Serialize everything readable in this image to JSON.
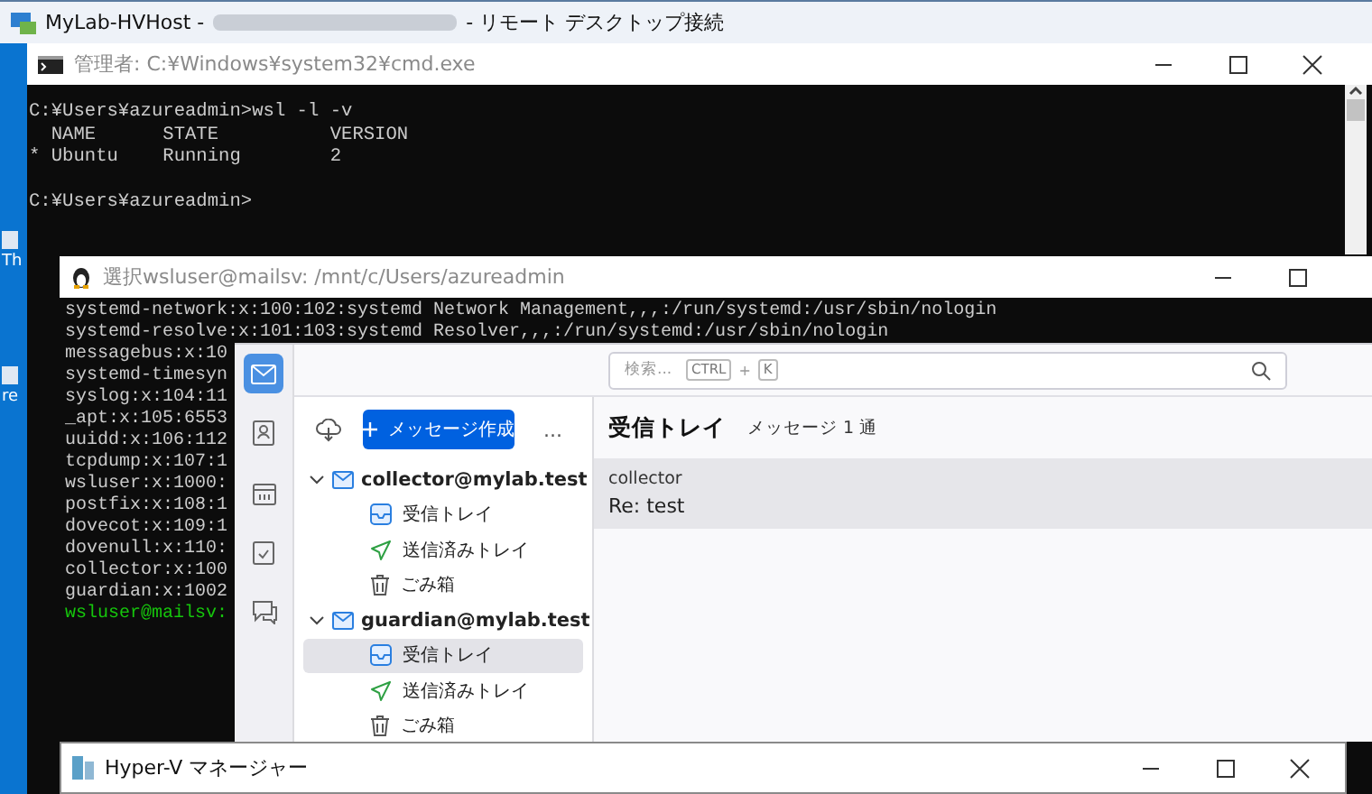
{
  "rdp_window": {
    "title_prefix": "MyLab-HVHost -",
    "title_suffix": "- リモート デスクトップ接続"
  },
  "desktop_icons": [
    {
      "label": "Th"
    },
    {
      "label": "re"
    }
  ],
  "cmd_window": {
    "title": "管理者: C:¥Windows¥system32¥cmd.exe",
    "active": false,
    "blocks": [
      [
        "C:¥Users¥azureadmin>wsl -l -v",
        "  NAME      STATE          VERSION",
        "* Ubuntu    Running        2"
      ],
      [
        "C:¥Users¥azureadmin>"
      ]
    ]
  },
  "wsl_window": {
    "title": "選択wsluser@mailsv: /mnt/c/Users/azureadmin",
    "active": false,
    "lines": [
      {
        "kind": "output",
        "text": "systemd-network:x:100:102:systemd Network Management,,,:/run/systemd:/usr/sbin/nologin"
      },
      {
        "kind": "output",
        "text": "systemd-resolve:x:101:103:systemd Resolver,,,:/run/systemd:/usr/sbin/nologin"
      },
      {
        "kind": "output",
        "text": "messagebus:x:10"
      },
      {
        "kind": "output",
        "text": "systemd-timesyn"
      },
      {
        "kind": "output",
        "text": "syslog:x:104:11"
      },
      {
        "kind": "output",
        "text": "_apt:x:105:6553"
      },
      {
        "kind": "output",
        "text": "uuidd:x:106:112"
      },
      {
        "kind": "output",
        "text": "tcpdump:x:107:1"
      },
      {
        "kind": "output",
        "text": "wsluser:x:1000:"
      },
      {
        "kind": "output",
        "text": "postfix:x:108:1"
      },
      {
        "kind": "output",
        "text": "dovecot:x:109:1"
      },
      {
        "kind": "output",
        "text": "dovenull:x:110:"
      },
      {
        "kind": "output",
        "text": "collector:x:100"
      },
      {
        "kind": "output",
        "text": "guardian:x:1002"
      },
      {
        "kind": "prompt",
        "text": "wsluser@mailsv:"
      }
    ]
  },
  "mail_app": {
    "spaces": [
      {
        "kind": "mail",
        "selected": true
      },
      {
        "kind": "address-book",
        "selected": false
      },
      {
        "kind": "calendar",
        "selected": false
      },
      {
        "kind": "tasks",
        "selected": false
      },
      {
        "kind": "chat",
        "selected": false
      }
    ],
    "search": {
      "placeholder": "検索...",
      "shortcut_keys": [
        "CTRL",
        "K"
      ],
      "shortcut_joiner": "+"
    },
    "compose_button": "メッセージ作成",
    "more_button": "...",
    "accounts": [
      {
        "name": "collector@mylab.test",
        "expanded": true,
        "folders": [
          {
            "kind": "inbox",
            "name": "受信トレイ",
            "selected": false
          },
          {
            "kind": "sent",
            "name": "送信済みトレイ",
            "selected": false
          },
          {
            "kind": "trash",
            "name": "ごみ箱",
            "selected": false
          }
        ]
      },
      {
        "name": "guardian@mylab.test",
        "expanded": true,
        "folders": [
          {
            "kind": "inbox",
            "name": "受信トレイ",
            "selected": true
          },
          {
            "kind": "sent",
            "name": "送信済みトレイ",
            "selected": false
          },
          {
            "kind": "trash",
            "name": "ごみ箱",
            "selected": false
          }
        ]
      }
    ],
    "message_list": {
      "folder": "受信トレイ",
      "count": "メッセージ 1 通",
      "messages": [
        {
          "sender": "collector",
          "subject": "Re: test",
          "selected": true
        }
      ]
    }
  },
  "hyperv_window": {
    "title": "Hyper-V マネージャー"
  }
}
